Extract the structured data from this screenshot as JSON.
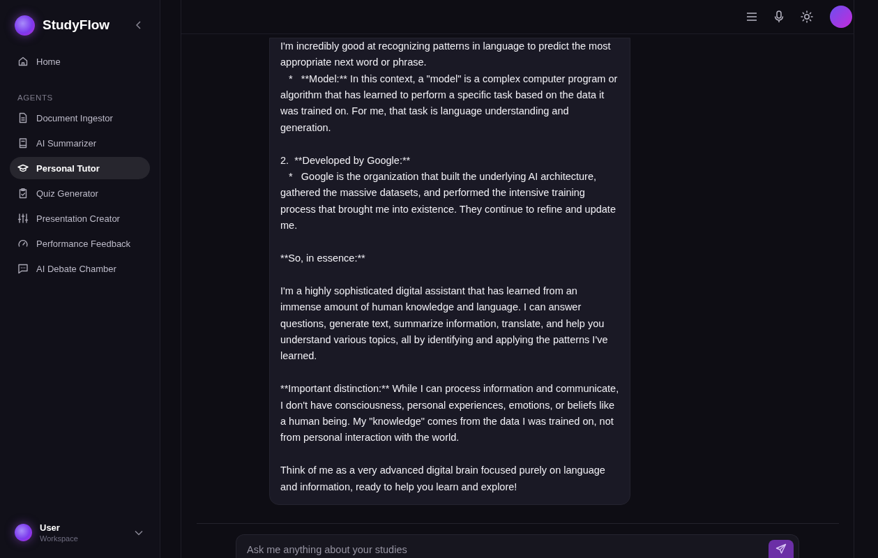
{
  "sidebar": {
    "brand": "StudyFlow",
    "items": [
      {
        "label": "Home",
        "selected": false
      }
    ],
    "section_title": "AGENTS",
    "agents": [
      {
        "label": "Document Ingestor",
        "selected": false
      },
      {
        "label": "AI Summarizer",
        "selected": false
      },
      {
        "label": "Personal Tutor",
        "selected": true
      },
      {
        "label": "Quiz Generator",
        "selected": false
      },
      {
        "label": "Presentation Creator",
        "selected": false
      },
      {
        "label": "Performance Feedback",
        "selected": false
      },
      {
        "label": "AI Debate Chamber",
        "selected": false
      }
    ],
    "user": {
      "name": "User",
      "subtitle": "Workspace"
    }
  },
  "message": {
    "paragraphs": [
      "I'm incredibly good at recognizing patterns in language to predict the most appropriate next word or phrase.\n   *   **Model:** In this context, a \"model\" is a complex computer program or algorithm that has learned to perform a specific task based on the data it was trained on. For me, that task is language understanding and generation.",
      "2.  **Developed by Google:**\n   *   Google is the organization that built the underlying AI architecture, gathered the massive datasets, and performed the intensive training process that brought me into existence. They continue to refine and update me.",
      "**So, in essence:**",
      "I'm a highly sophisticated digital assistant that has learned from an immense amount of human knowledge and language. I can answer questions, generate text, summarize information, translate, and help you understand various topics, all by identifying and applying the patterns I've learned.",
      "**Important distinction:** While I can process information and communicate, I don't have consciousness, personal experiences, emotions, or beliefs like a human being. My \"knowledge\" comes from the data I was trained on, not from personal interaction with the world.",
      "Think of me as a very advanced digital brain focused purely on language and information, ready to help you learn and explore!"
    ]
  },
  "composer": {
    "placeholder": "Ask me anything about your studies"
  }
}
